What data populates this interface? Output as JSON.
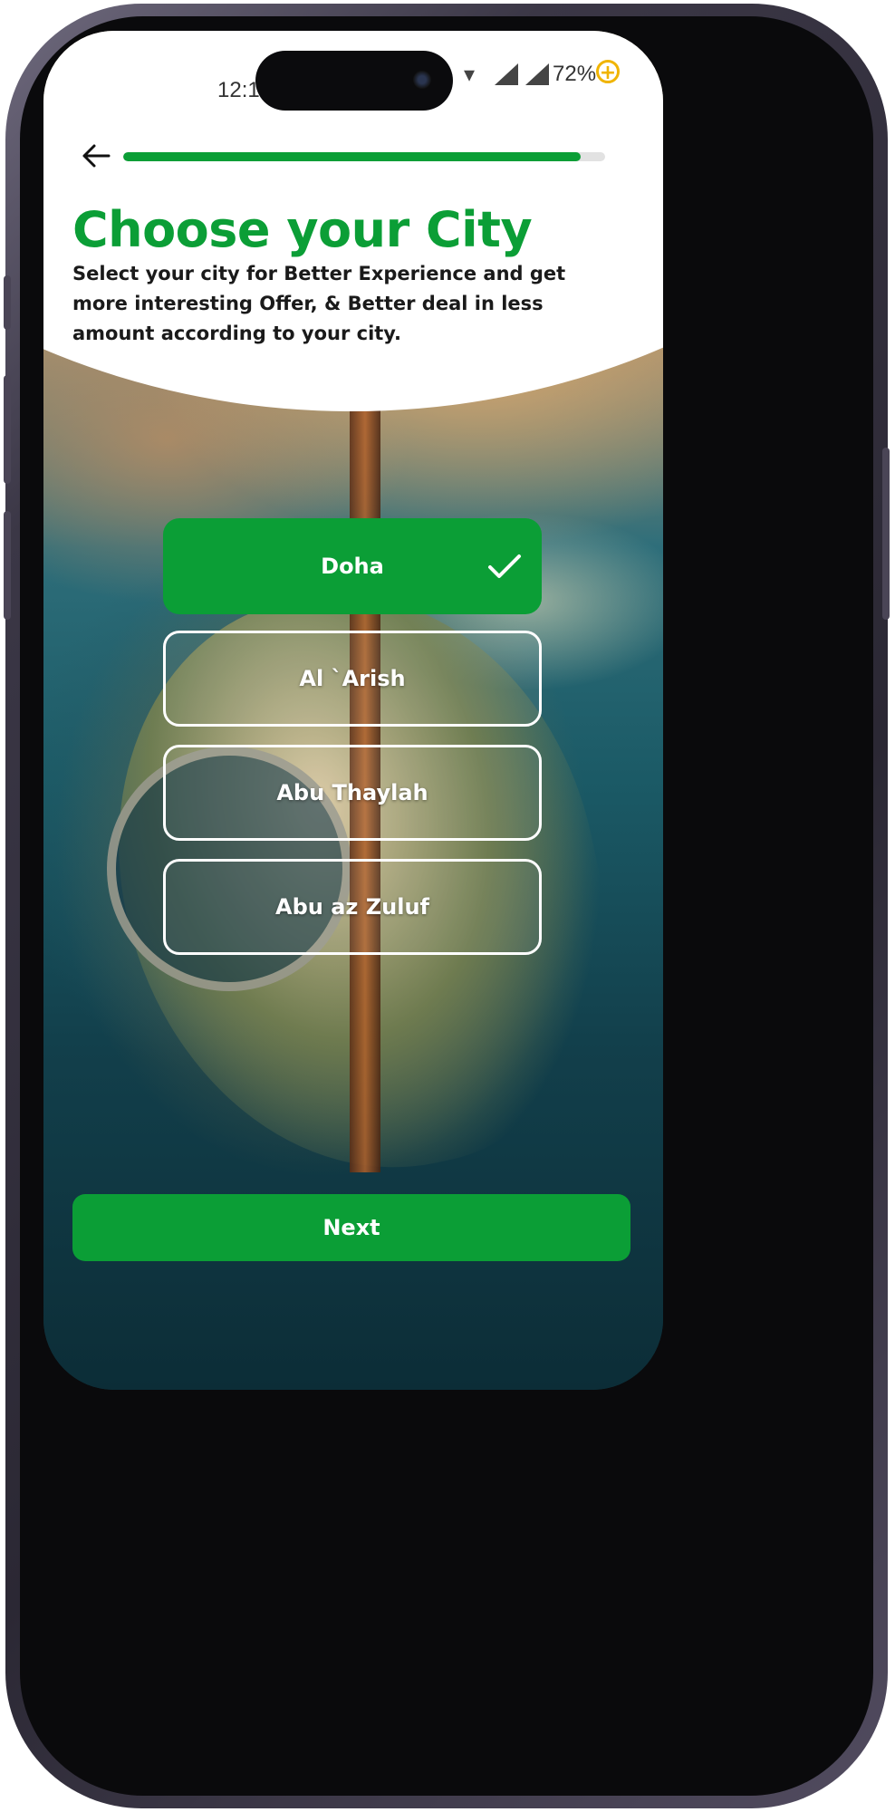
{
  "status_bar": {
    "time": "12:1",
    "battery": "72%",
    "wifi_icon": "wifi-icon",
    "signal_icon": "signal-icon",
    "charge_icon": "charging-icon"
  },
  "header": {
    "back_icon": "arrow-left-icon",
    "progress_fraction": 0.95
  },
  "title": "Choose your City",
  "subtitle": "Select your city for Better Experience and get more interesting Offer, & Better deal in less amount according to your city.",
  "cities": [
    {
      "label": "Doha",
      "selected": true
    },
    {
      "label": "Al `Arish",
      "selected": false
    },
    {
      "label": "Abu Thaylah",
      "selected": false
    },
    {
      "label": "Abu az Zuluf",
      "selected": false
    }
  ],
  "next_label": "Next",
  "colors": {
    "accent_green": "#0b9e36",
    "progress_track": "#e2e2e2",
    "text_dark": "#1a1a1a"
  }
}
